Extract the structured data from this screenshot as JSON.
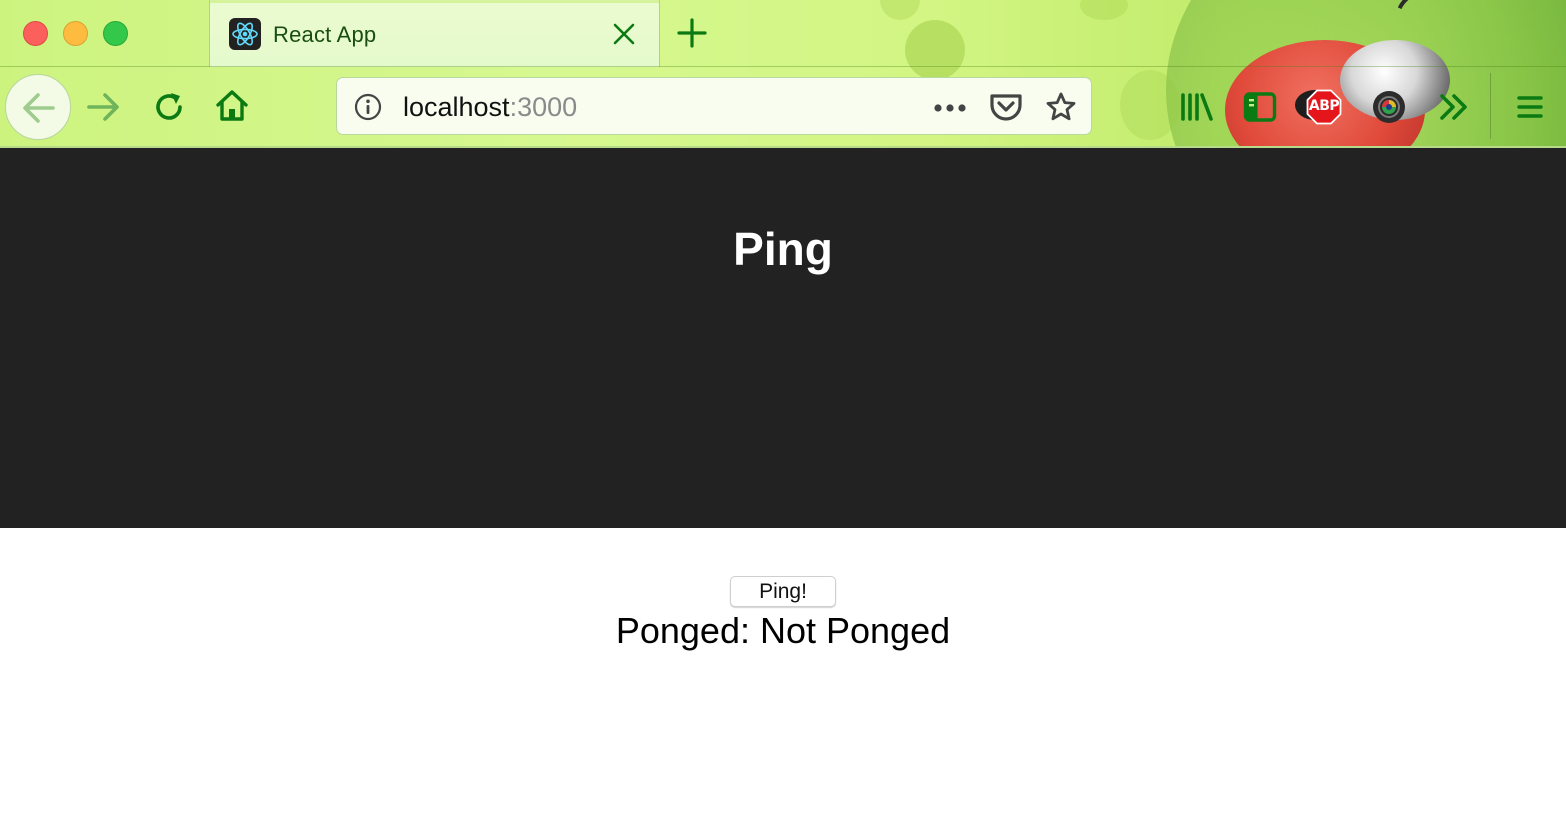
{
  "browser": {
    "tab": {
      "title": "React App"
    },
    "urlbar": {
      "host": "localhost",
      "port": ":3000"
    },
    "toolbar_icons": [
      "library-icon",
      "sidebar-icon",
      "adblock-plus-icon",
      "camera-icon",
      "overflow-chevron-icon",
      "hamburger-menu-icon"
    ],
    "extensions": {
      "adblock_label": "ABP"
    },
    "accent_color": "#0b7a12"
  },
  "app": {
    "header": {
      "title": "Ping"
    },
    "ping_button": {
      "label": "Ping!"
    },
    "status": {
      "text": "Ponged: Not Ponged"
    }
  }
}
